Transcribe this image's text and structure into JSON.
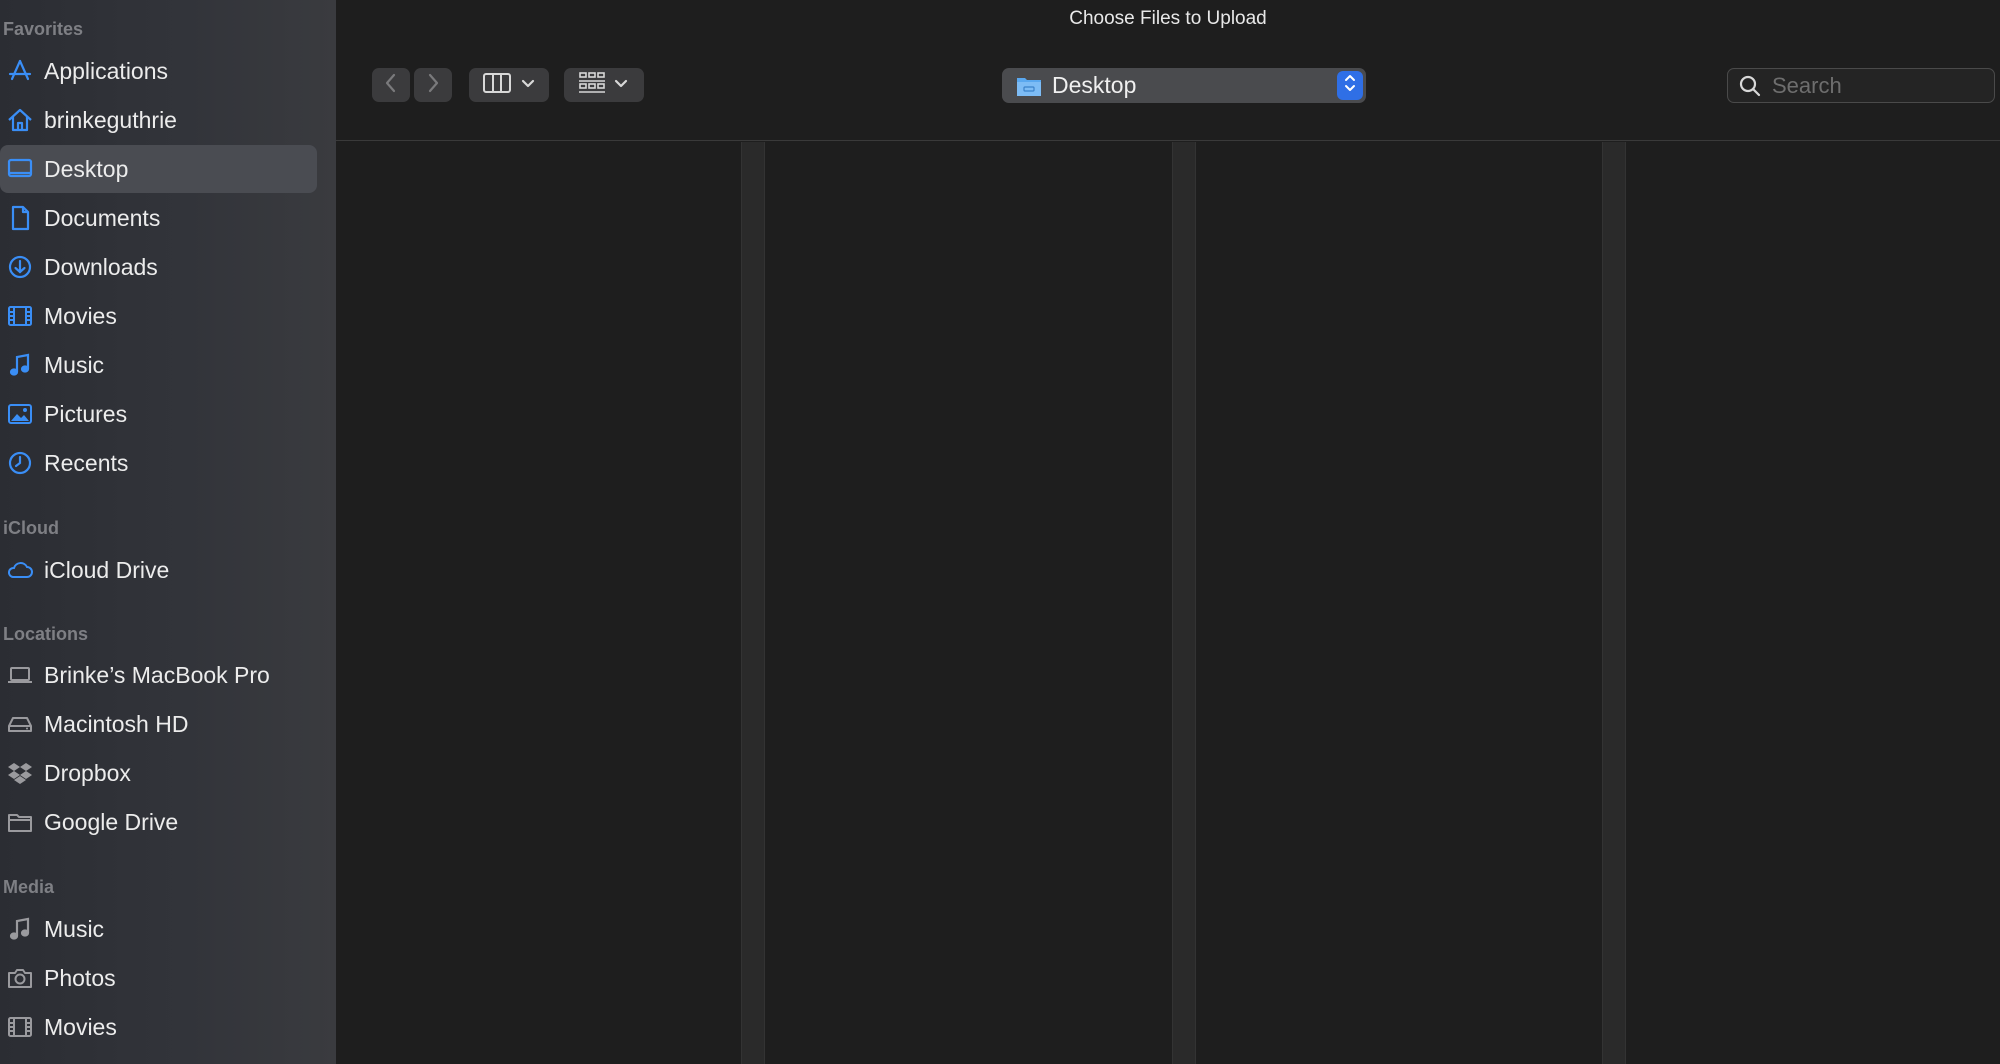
{
  "window": {
    "title": "Choose Files to Upload"
  },
  "sidebar": {
    "sections": [
      {
        "title": "Favorites",
        "items": [
          {
            "label": "Applications",
            "icon": "applications-icon"
          },
          {
            "label": "brinkeguthrie",
            "icon": "home-icon"
          },
          {
            "label": "Desktop",
            "icon": "desktop-icon",
            "selected": true
          },
          {
            "label": "Documents",
            "icon": "document-icon"
          },
          {
            "label": "Downloads",
            "icon": "downloads-icon"
          },
          {
            "label": "Movies",
            "icon": "film-icon"
          },
          {
            "label": "Music",
            "icon": "music-note-icon"
          },
          {
            "label": "Pictures",
            "icon": "photo-icon"
          },
          {
            "label": "Recents",
            "icon": "clock-icon"
          }
        ]
      },
      {
        "title": "iCloud",
        "items": [
          {
            "label": "iCloud Drive",
            "icon": "cloud-icon"
          }
        ]
      },
      {
        "title": "Locations",
        "items": [
          {
            "label": "Brinke’s MacBook Pro",
            "icon": "laptop-icon"
          },
          {
            "label": "Macintosh HD",
            "icon": "hard-drive-icon"
          },
          {
            "label": "Dropbox",
            "icon": "dropbox-icon"
          },
          {
            "label": "Google Drive",
            "icon": "folder-icon"
          }
        ]
      },
      {
        "title": "Media",
        "items": [
          {
            "label": "Music",
            "icon": "music-note-icon"
          },
          {
            "label": "Photos",
            "icon": "camera-icon"
          },
          {
            "label": "Movies",
            "icon": "film-icon"
          }
        ]
      }
    ]
  },
  "toolbar": {
    "path_label": "Desktop",
    "search_placeholder": "Search"
  },
  "colors": {
    "accent": "#2f6fe6",
    "sidebar_icon": "#3a8ef6",
    "location_icon": "#9a9a9e"
  }
}
